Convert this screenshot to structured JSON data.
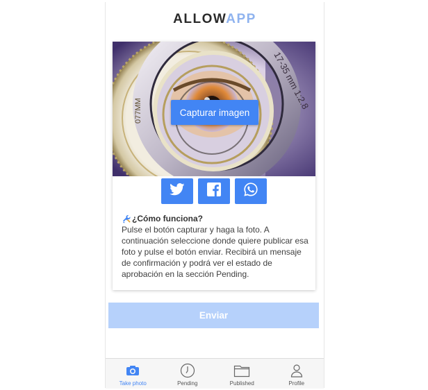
{
  "app": {
    "logo_main": "ALLOW",
    "logo_accent": "APP"
  },
  "photo": {
    "capture_label": "Capturar imagen",
    "lens_text_right": "17-35 mm 1:2.8",
    "lens_text_left": "077MM"
  },
  "share": [
    {
      "icon": "twitter-icon"
    },
    {
      "icon": "facebook-icon"
    },
    {
      "icon": "whatsapp-icon"
    }
  ],
  "how": {
    "title": "¿Cómo funciona?",
    "body": "Pulse el botón capturar y haga la foto. A continuación seleccione donde quiere publicar esa foto y pulse el botón enviar. Recibirá un mensaje de confirmación y podrá ver el estado de aprobación en la sección Pending."
  },
  "send_label": "Enviar",
  "tabs": [
    {
      "label": "Take photo",
      "icon": "camera-icon",
      "active": true
    },
    {
      "label": "Pending",
      "icon": "clock-icon",
      "active": false
    },
    {
      "label": "Published",
      "icon": "folder-icon",
      "active": false
    },
    {
      "label": "Profile",
      "icon": "user-icon",
      "active": false
    }
  ],
  "colors": {
    "accent": "#4285f4",
    "send_disabled": "#b6d1fb",
    "logo_accent": "#8fb3ef"
  }
}
